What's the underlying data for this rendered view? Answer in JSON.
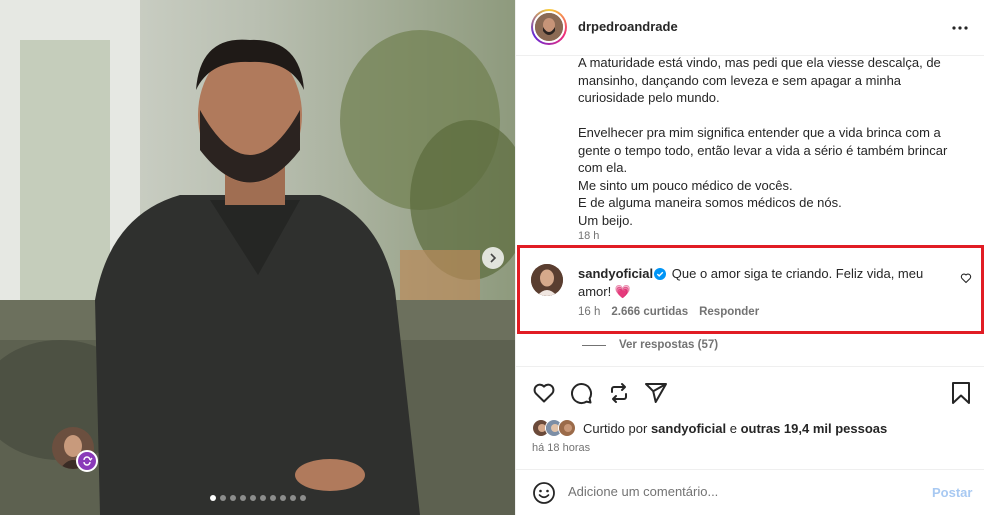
{
  "post": {
    "author": "drpedroandrade",
    "more_icon": "more-horizontal-icon",
    "caption_lines": [
      "A maturidade está vindo, mas pedi que ela viesse descalça, de",
      "mansinho, dançando com leveza e sem apagar a minha",
      "curiosidade pelo mundo.",
      "",
      "Envelhecer pra mim significa entender que a vida brinca com a",
      "gente o tempo todo, então levar a vida a sério é também brincar",
      "com ela.",
      "Me sinto um pouco médico de vocês.",
      "E de alguma maneira somos médicos de nós.",
      "Um beijo."
    ],
    "caption_time": "18 h",
    "carousel": {
      "dot_count": 10,
      "active_index": 0
    }
  },
  "comment": {
    "user": "sandyoficial",
    "verified": true,
    "text_line1": "Que o amor siga te criando. Feliz vida, meu",
    "text_line2": "amor!",
    "emoji": "💗",
    "time": "16 h",
    "likes": "2.666 curtidas",
    "reply_label": "Responder",
    "view_replies": "Ver respostas (57)",
    "highlight_color": "#e11c24"
  },
  "footer": {
    "liked_prefix": "Curtido por",
    "liked_user": "sandyoficial",
    "liked_and": "e",
    "liked_others": "outras 19,4 mil pessoas",
    "post_time": "há 18 horas",
    "comment_placeholder": "Adicione um comentário...",
    "post_label": "Postar"
  },
  "icons": [
    "like-icon",
    "comment-icon",
    "share-icon",
    "send-icon",
    "save-icon",
    "emoji-icon",
    "chevron-right-icon",
    "verified-icon",
    "heart-outline-icon",
    "collab-icon"
  ],
  "colors": {
    "text": "#262626",
    "muted": "#737373",
    "post_disabled": "#a8c9f2",
    "verified": "#0095f6",
    "collab_badge": "#8a3ab9"
  }
}
